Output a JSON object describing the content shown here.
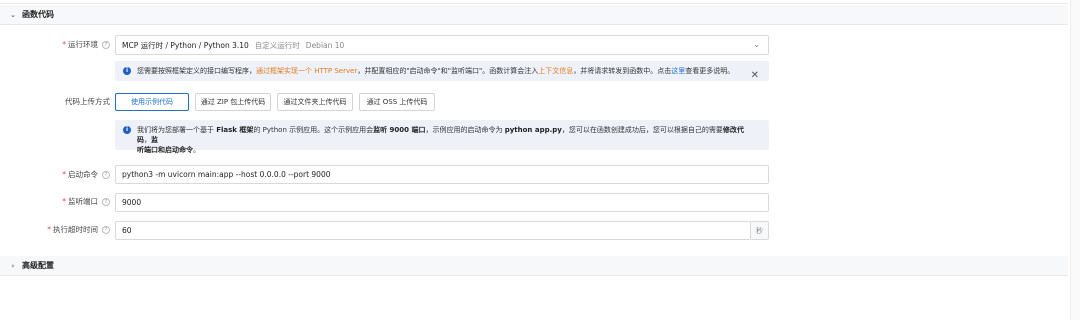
{
  "section_code": {
    "title": "函数代码"
  },
  "runtime": {
    "label": "运行环境",
    "main": "MCP 运行时 / Python / Python 3.10",
    "sub1": "自定义运行时",
    "sub2": "Debian 10"
  },
  "notice1": {
    "text1": "您需要按照框架定义的接口编写程序，",
    "link1": "通过框架实现一个 HTTP Server",
    "text2": "，并配置相应的\"启动命令\"和\"监听端口\"。函数计算会注入",
    "link2": "上下文信息",
    "text3": "，并将请求转发到函数中。点击",
    "link3": "这里",
    "text4": "查看更多说明。"
  },
  "upload": {
    "label": "代码上传方式",
    "options": [
      "使用示例代码",
      "通过 ZIP 包上传代码",
      "通过文件夹上传代码",
      "通过 OSS 上传代码"
    ]
  },
  "notice2": {
    "t1": "我们将为您部署一个基于 ",
    "b1": "Flask 框架",
    "t2": "的 Python 示例应用。这个示例应用会",
    "b2": "监听 9000 端口",
    "t3": "，示例应用的启动命令为 ",
    "b3": "python app.py",
    "t4": "，您可以在函数创建成功后，您可以根据自己的需要",
    "b4": "修改代码",
    "t5": "，",
    "b5": "监",
    "b6": "听端口和启动命令",
    "t6": "。"
  },
  "start_cmd": {
    "label": "启动命令",
    "value": "python3 -m uvicorn main:app --host 0.0.0.0 --port 9000"
  },
  "port": {
    "label": "监听端口",
    "value": "9000"
  },
  "timeout": {
    "label": "执行超时时间",
    "value": "60",
    "unit": "秒"
  },
  "section_advanced": {
    "title": "高级配置"
  },
  "icons": {
    "info": "info-icon",
    "close": "close-icon",
    "help": "help-icon",
    "chevron": "chevron-icon"
  },
  "colors": {
    "accent": "#1f6fd6",
    "link_orange": "#e07a1f",
    "required": "#e5484d",
    "notice_bg": "#eef2f8"
  }
}
